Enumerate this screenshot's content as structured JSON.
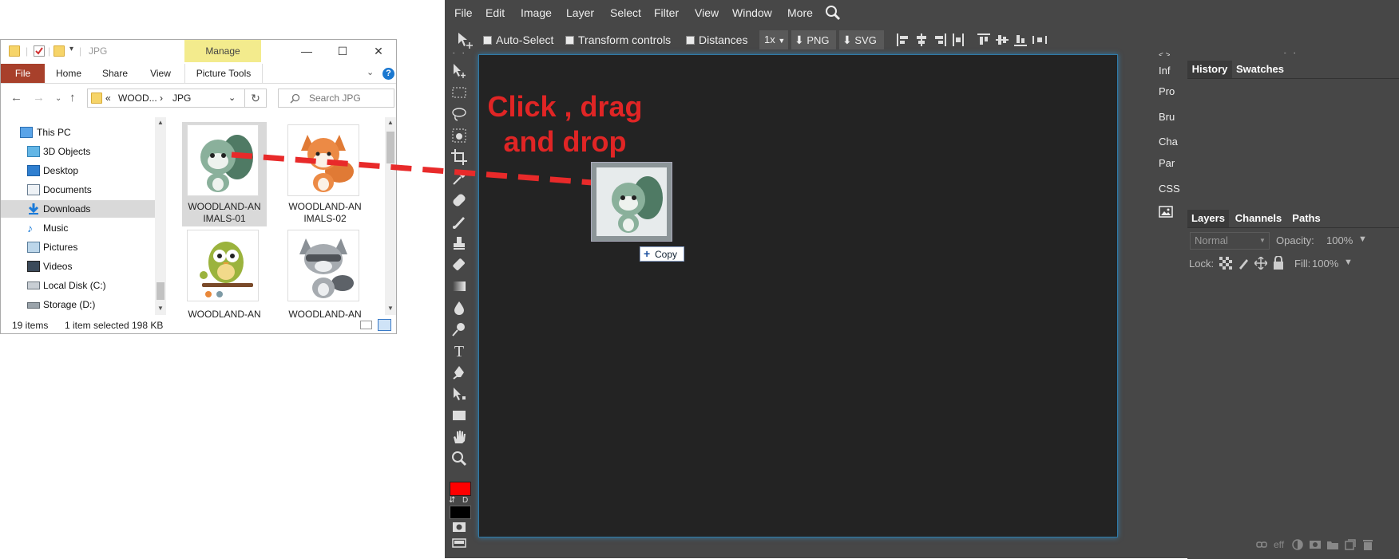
{
  "explorer": {
    "title": "JPG",
    "manage_label": "Manage",
    "ribbon_tabs": [
      "File",
      "Home",
      "Share",
      "View",
      "Picture Tools"
    ],
    "window_controls": {
      "minimize": "—",
      "maximize": "☐",
      "close": "✕"
    },
    "help_label": "?",
    "address": {
      "chevrons": "«",
      "segment1": "WOOD...",
      "separator": "›",
      "segment2": "JPG"
    },
    "search_placeholder": "Search JPG",
    "tree_items": [
      {
        "label": "This PC",
        "icon": "pc-icon"
      },
      {
        "label": "3D Objects",
        "icon": "3d-objects-icon"
      },
      {
        "label": "Desktop",
        "icon": "desktop-icon"
      },
      {
        "label": "Documents",
        "icon": "documents-icon"
      },
      {
        "label": "Downloads",
        "icon": "downloads-icon",
        "selected": true
      },
      {
        "label": "Music",
        "icon": "music-icon"
      },
      {
        "label": "Pictures",
        "icon": "pictures-icon"
      },
      {
        "label": "Videos",
        "icon": "videos-icon"
      },
      {
        "label": "Local Disk (C:)",
        "icon": "local-disk-icon"
      },
      {
        "label": "Storage (D:)",
        "icon": "storage-drive-icon"
      }
    ],
    "files": [
      {
        "line1": "WOODLAND-AN",
        "line2": "IMALS-01",
        "selected": true
      },
      {
        "line1": "WOODLAND-AN",
        "line2": "IMALS-02"
      },
      {
        "line1": "WOODLAND-AN",
        "line2": ""
      },
      {
        "line1": "WOODLAND-AN",
        "line2": ""
      }
    ],
    "status": {
      "count": "19 items",
      "selection": "1 item selected",
      "size": "198 KB"
    }
  },
  "photopea": {
    "menu": [
      "File",
      "Edit",
      "Image",
      "Layer",
      "Select",
      "Filter",
      "View",
      "Window",
      "More"
    ],
    "options": {
      "auto_select": "Auto-Select",
      "transform_controls": "Transform controls",
      "distances": "Distances",
      "zoom": "1x",
      "png": "PNG",
      "svg": "SVG"
    },
    "collapse_left": "> <",
    "collapse_mid": "< >",
    "collapse_right": "> <",
    "icon_strip": [
      "Inf",
      "Pro",
      "Bru",
      "Cha",
      "Par",
      "CSS"
    ],
    "history_tabs": [
      "History",
      "Swatches"
    ],
    "layers_tabs": [
      "Layers",
      "Channels",
      "Paths"
    ],
    "blend_mode": "Normal",
    "opacity_label": "Opacity:",
    "opacity_value": "100%",
    "lock_label": "Lock:",
    "fill_label": "Fill:",
    "fill_value": "100%",
    "eff_label": "eff",
    "swap_label": "⇵",
    "default_label": "D",
    "foreground_color": "#ff0000",
    "background_color": "#000000"
  },
  "overlay": {
    "line1": "Click , drag",
    "line2": "and drop",
    "copy_label": "Copy",
    "copy_plus": "+"
  }
}
